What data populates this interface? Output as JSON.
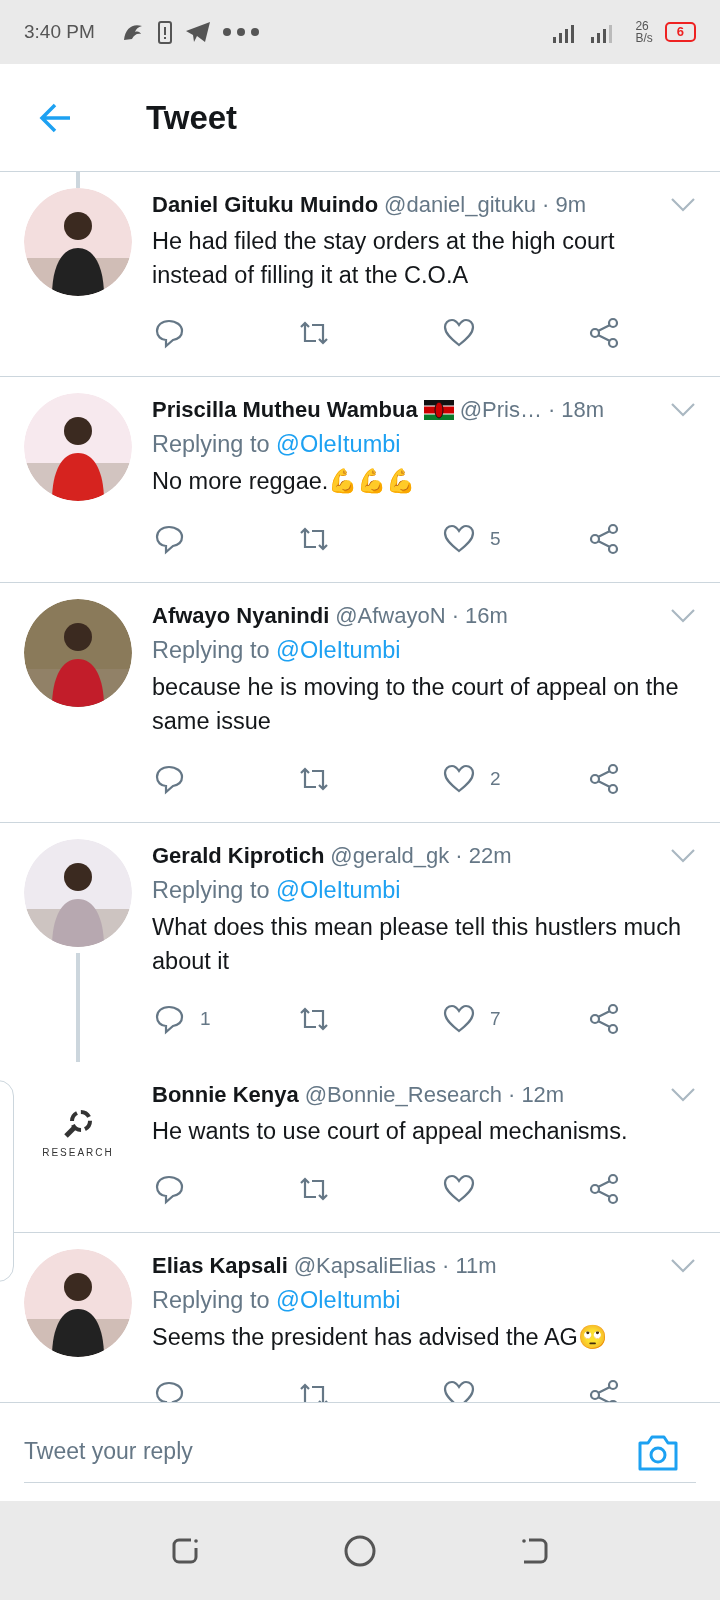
{
  "status_bar": {
    "time": "3:40 PM",
    "speed_value": "26",
    "speed_unit": "B/s",
    "battery": "6"
  },
  "header": {
    "title": "Tweet"
  },
  "tweets": [
    {
      "name": "Daniel Gituku Muindo",
      "handle": "@daniel_gituku",
      "time": "· 9m",
      "text": "He had filed the stay orders at the high court instead of filling it at the C.O.A",
      "thread_above": true
    },
    {
      "name": "Priscilla Mutheu Wambua",
      "flag": true,
      "handle": "@Pris…",
      "time": "· 18m",
      "replying_to": {
        "label": "Replying to",
        "handle": "@OleItumbi"
      },
      "text": "No more reggae.💪💪💪",
      "likes": "5"
    },
    {
      "name": "Afwayo Nyanindi",
      "handle": "@AfwayoN",
      "time": "· 16m",
      "replying_to": {
        "label": "Replying to",
        "handle": "@OleItumbi"
      },
      "text": "because he is moving to the court of appeal on the same issue",
      "likes": "2"
    },
    {
      "name": "Gerald Kiprotich",
      "handle": "@gerald_gk",
      "time": "· 22m",
      "replying_to": {
        "label": "Replying to",
        "handle": "@OleItumbi"
      },
      "text": "What does this mean please tell this hustlers much about it",
      "replies": "1",
      "likes": "7",
      "thread_below": true
    },
    {
      "name": "Bonnie Kenya",
      "handle": "@Bonnie_Research",
      "time": "· 12m",
      "text": "He wants to use court of appeal mechanisms.",
      "avatar": {
        "kind": "logo",
        "text": "RESEARCH"
      }
    },
    {
      "name": "Elias Kapsali",
      "handle": "@KapsaliElias",
      "time": "· 11m",
      "replying_to": {
        "label": "Replying to",
        "handle": "@OleItumbi"
      },
      "text": "Seems the president has advised the AG🙄"
    }
  ],
  "reply_bar": {
    "placeholder": "Tweet your reply"
  }
}
